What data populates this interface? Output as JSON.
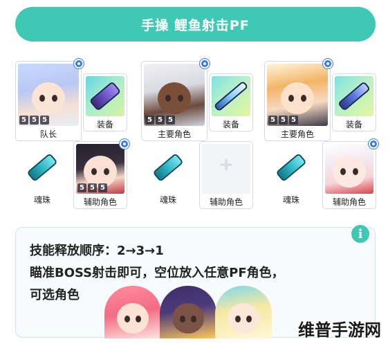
{
  "title": "手操 鲤鱼射击PF",
  "groups": [
    {
      "main": {
        "label": "队长",
        "levels": [
          "5",
          "5",
          "5"
        ]
      },
      "equip": {
        "label": "装备"
      },
      "soul": {
        "label": "魂珠"
      },
      "support": {
        "label": "辅助角色",
        "levels": [
          "5",
          "5",
          "5"
        ]
      }
    },
    {
      "main": {
        "label": "主要角色",
        "levels": [
          "5",
          "5",
          "5"
        ]
      },
      "equip": {
        "label": "装备"
      },
      "soul": {
        "label": "魂珠"
      },
      "support": {
        "label": "辅助角色"
      }
    },
    {
      "main": {
        "label": "主要角色",
        "levels": [
          "5",
          "5",
          "5"
        ]
      },
      "equip": {
        "label": "装备"
      },
      "soul": {
        "label": "魂珠"
      },
      "support": {
        "label": "辅助角色"
      }
    }
  ],
  "info": {
    "icon": "i",
    "lines": [
      "技能释放顺序：2→3→1",
      "瞄准BOSS射击即可，空位放入任意PF角色，",
      "可选角色"
    ]
  },
  "watermark": "维普手游网",
  "colors": {
    "accent": "#3fc9b4",
    "check": "#3a7be8"
  }
}
